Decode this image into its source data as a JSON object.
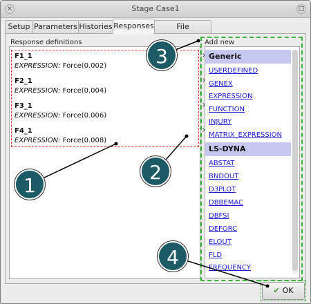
{
  "window": {
    "title": "Stage Case1",
    "close_glyph": "×",
    "max_glyph": "□"
  },
  "tabs": [
    {
      "label": "Setup"
    },
    {
      "label": "Parameters"
    },
    {
      "label": "Histories"
    },
    {
      "label": "Responses",
      "active": true
    },
    {
      "label": "File Operations"
    }
  ],
  "responses": {
    "label": "Response definitions",
    "delete_glyph": "×",
    "items": [
      {
        "name": "F1_1",
        "expr_key": "EXPRESSION:",
        "expr_value": "Force(0.002)"
      },
      {
        "name": "F2_1",
        "expr_key": "EXPRESSION:",
        "expr_value": "Force(0.004)"
      },
      {
        "name": "F3_1",
        "expr_key": "EXPRESSION:",
        "expr_value": "Force(0.006)"
      },
      {
        "name": "F4_1",
        "expr_key": "EXPRESSION:",
        "expr_value": "Force(0.008)"
      }
    ]
  },
  "add_new": {
    "label": "Add new",
    "categories": [
      {
        "name": "Generic",
        "options": [
          "USERDEFINED",
          "GENEX",
          "EXPRESSION",
          "FUNCTION",
          "INJURY",
          "MATRIX_EXPRESSION"
        ]
      },
      {
        "name": "LS-DYNA",
        "options": [
          "ABSTAT",
          "BNDOUT",
          "D3PLOT",
          "DBBEMAC",
          "DBFSI",
          "DEFORC",
          "ELOUT",
          "FLD",
          "FREQUENCY"
        ]
      }
    ]
  },
  "ok_button": {
    "label": "OK",
    "check_glyph": "✔"
  },
  "callouts": [
    "1",
    "2",
    "3",
    "4"
  ],
  "colors": {
    "accent_circle": "#1c5a66",
    "category_bg": "#c7c8f2",
    "link": "#1a1ad6",
    "red_dash": "#e8312e",
    "green_dash": "#3bb33b"
  }
}
